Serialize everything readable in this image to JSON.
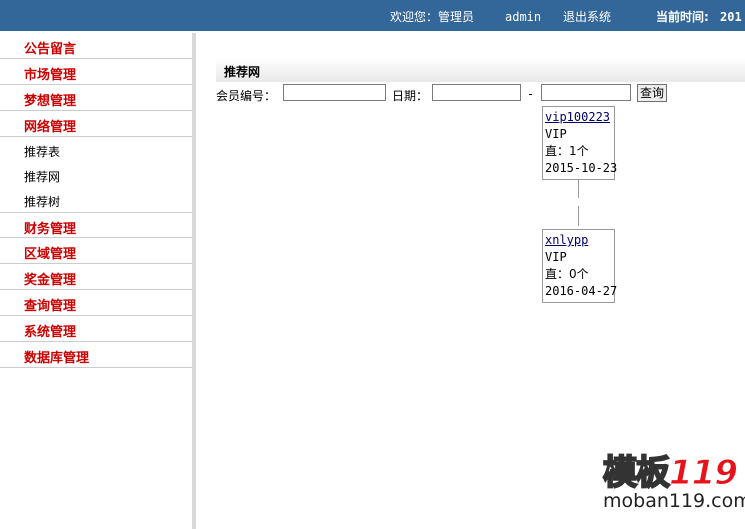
{
  "header": {
    "welcome": "欢迎您：管理员",
    "user": "admin",
    "logout": "退出系统",
    "time_label": "当前时间:",
    "time_value": "201"
  },
  "sidebar": {
    "items": [
      {
        "label": "公告留言",
        "kind": "category"
      },
      {
        "label": "市场管理",
        "kind": "category"
      },
      {
        "label": "梦想管理",
        "kind": "category"
      },
      {
        "label": "网络管理",
        "kind": "category"
      },
      {
        "label": "推荐表",
        "kind": "sub"
      },
      {
        "label": "推荐网",
        "kind": "sub"
      },
      {
        "label": "推荐树",
        "kind": "sub"
      },
      {
        "label": "财务管理",
        "kind": "category"
      },
      {
        "label": "区域管理",
        "kind": "category"
      },
      {
        "label": "奖金管理",
        "kind": "category"
      },
      {
        "label": "查询管理",
        "kind": "category"
      },
      {
        "label": "系统管理",
        "kind": "category"
      },
      {
        "label": "数据库管理",
        "kind": "category"
      }
    ]
  },
  "main": {
    "title": "推荐网",
    "filter": {
      "member_label": "会员编号：",
      "member_value": "",
      "date_label": "日期：",
      "date_from": "",
      "separator": "-",
      "date_to": "",
      "query_button": "查询"
    },
    "tree": [
      {
        "id": "vip100223",
        "level": "VIP",
        "direct": "直：1个",
        "date": "2015-10-23"
      },
      {
        "id": "xnlypp",
        "level": "VIP",
        "direct": "直：0个",
        "date": "2016-04-27"
      }
    ]
  },
  "watermark": {
    "logo_text": "模板",
    "logo_num": "119",
    "url": "moban119.com"
  }
}
